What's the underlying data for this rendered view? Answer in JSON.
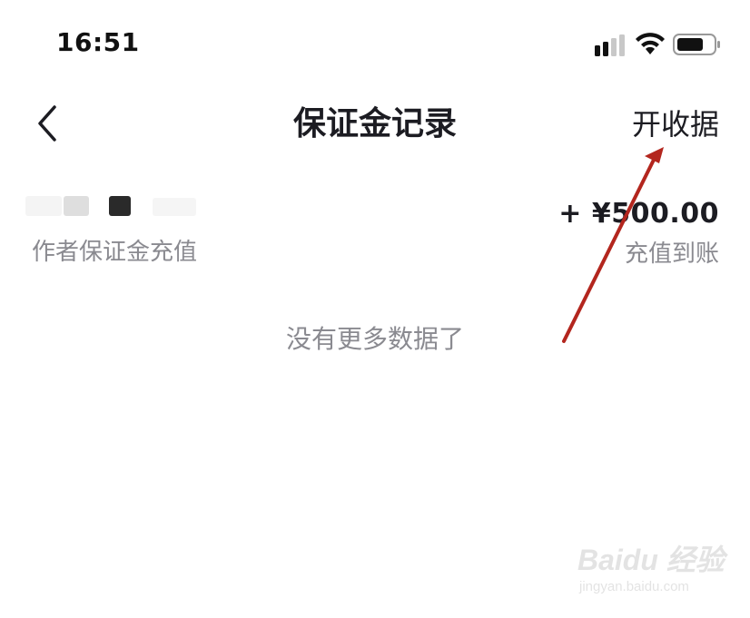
{
  "status_bar": {
    "time": "16:51",
    "icons": [
      "signal-icon",
      "wifi-icon",
      "battery-icon"
    ]
  },
  "nav": {
    "back_icon": "chevron-left-icon",
    "title": "保证金记录",
    "action_label": "开收据"
  },
  "records": [
    {
      "amount": "+ ¥500.00",
      "description": "作者保证金充值",
      "status": "充值到账"
    }
  ],
  "footer_note": "没有更多数据了",
  "watermark": {
    "brand": "Baidu 经验",
    "url": "jingyan.baidu.com"
  },
  "colors": {
    "annotation_arrow": "#b3261e",
    "secondary_text": "#8a8a90",
    "primary_text": "#1c1c22"
  }
}
